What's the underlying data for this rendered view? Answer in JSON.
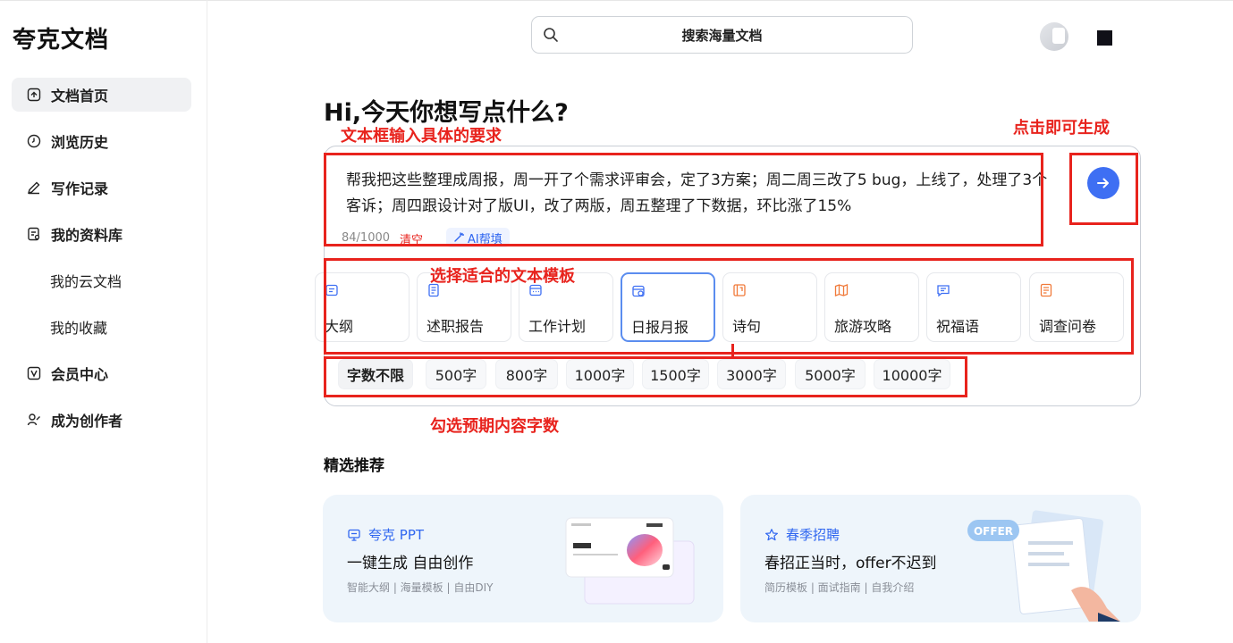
{
  "app": {
    "logo": "夸克文档"
  },
  "sidebar": {
    "items": [
      {
        "label": "文档首页",
        "icon": "home-icon",
        "active": true
      },
      {
        "label": "浏览历史",
        "icon": "clock-icon"
      },
      {
        "label": "写作记录",
        "icon": "pen-icon"
      },
      {
        "label": "我的资料库",
        "icon": "library-icon"
      },
      {
        "label": "我的云文档",
        "sub": true
      },
      {
        "label": "我的收藏",
        "sub": true
      },
      {
        "label": "会员中心",
        "icon": "vip-icon"
      },
      {
        "label": "成为创作者",
        "icon": "creator-icon"
      }
    ]
  },
  "header": {
    "search_placeholder": "搜索海量文档"
  },
  "main": {
    "greeting": "Hi,今天你想写点什么?",
    "prompt": {
      "text": "帮我把这些整理成周报，周一开了个需求评审会，定了3方案；周二周三改了5 bug，上线了，处理了3个客诉；周四跟设计对了版UI，改了两版，周五整理了下数据，环比涨了15%",
      "counter": "84/1000",
      "clear_label": "清空",
      "ai_label": "AI帮填"
    },
    "templates": [
      {
        "label": "大纲",
        "icon": "outline-icon"
      },
      {
        "label": "述职报告",
        "icon": "report-icon"
      },
      {
        "label": "工作计划",
        "icon": "plan-icon"
      },
      {
        "label": "日报月报",
        "icon": "daily-report-icon",
        "selected": true
      },
      {
        "label": "诗句",
        "icon": "poem-icon"
      },
      {
        "label": "旅游攻略",
        "icon": "map-icon"
      },
      {
        "label": "祝福语",
        "icon": "message-icon"
      },
      {
        "label": "调查问卷",
        "icon": "survey-icon"
      }
    ],
    "word_counts": [
      "字数不限",
      "500字",
      "800字",
      "1000字",
      "1500字",
      "3000字",
      "5000字",
      "10000字"
    ],
    "selected_word_count": "字数不限",
    "section_title": "精选推荐",
    "recommend": [
      {
        "tag": "夸克 PPT",
        "title": "一键生成 自由创作",
        "subtitle": "智能大纲 | 海量模板 | 自由DIY"
      },
      {
        "tag": "春季招聘",
        "title": "春招正当时，offer不迟到",
        "subtitle": "简历模板 | 面试指南 | 自我介绍",
        "badge": "OFFER"
      }
    ]
  },
  "annotations": {
    "input_hint": "文本框输入具体的要求",
    "send_hint": "点击即可生成",
    "template_hint": "选择适合的文本模板",
    "wordcount_hint": "勾选预期内容字数"
  },
  "colors": {
    "accent": "#3e6ff3",
    "annotation": "#e8231d",
    "card_bg": "#eef5fb"
  }
}
